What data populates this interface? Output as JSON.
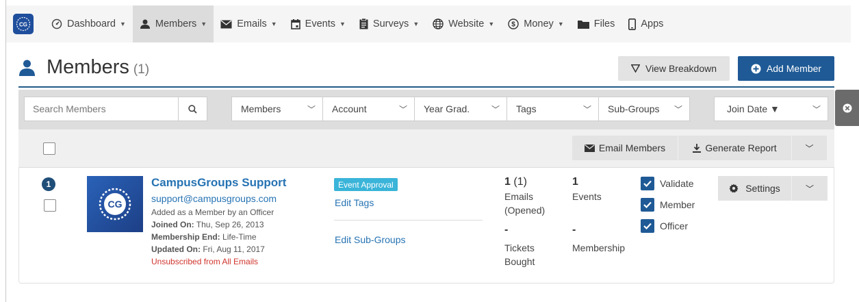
{
  "nav": {
    "items": [
      {
        "label": "Dashboard",
        "dropdown": true
      },
      {
        "label": "Members",
        "dropdown": true,
        "active": true
      },
      {
        "label": "Emails",
        "dropdown": true
      },
      {
        "label": "Events",
        "dropdown": true
      },
      {
        "label": "Surveys",
        "dropdown": true
      },
      {
        "label": "Website",
        "dropdown": true
      },
      {
        "label": "Money",
        "dropdown": true
      },
      {
        "label": "Files",
        "dropdown": false
      },
      {
        "label": "Apps",
        "dropdown": false
      }
    ],
    "logo_text": "CG"
  },
  "header": {
    "title": "Members",
    "count": "(1)",
    "view_breakdown": "View Breakdown",
    "add_member": "Add Member"
  },
  "filters": {
    "search_placeholder": "Search Members",
    "members": "Members",
    "account": "Account",
    "year_grad": "Year Grad.",
    "tags": "Tags",
    "sub_groups": "Sub-Groups",
    "join_date": "Join Date ▼"
  },
  "actions": {
    "email_members": "Email Members",
    "generate_report": "Generate Report"
  },
  "member": {
    "index": "1",
    "name": "CampusGroups Support",
    "email": "support@campusgroups.com",
    "added": "Added as a Member by an Officer",
    "joined_label": "Joined On:",
    "joined_value": "Thu, Sep 26, 2013",
    "membership_end_label": "Membership End:",
    "membership_end_value": "Life-Time",
    "updated_label": "Updated On:",
    "updated_value": "Fri, Aug 11, 2017",
    "unsubscribed": "Unsubscribed from All Emails",
    "tag": "Event Approval",
    "edit_tags": "Edit Tags",
    "edit_subgroups": "Edit Sub-Groups",
    "emails_count": "1",
    "emails_opened": "(1)",
    "emails_label_1": "Emails",
    "emails_label_2": "(Opened)",
    "events_count": "1",
    "events_label": "Events",
    "tickets_value": "-",
    "tickets_label_1": "Tickets",
    "tickets_label_2": "Bought",
    "membership_value": "-",
    "membership_label": "Membership",
    "roles": [
      {
        "label": "Validate",
        "checked": true
      },
      {
        "label": "Member",
        "checked": true
      },
      {
        "label": "Officer",
        "checked": true
      }
    ],
    "settings": "Settings"
  },
  "colors": {
    "primary": "#1f5a96",
    "link": "#2673b3",
    "tag": "#3ab4d9",
    "danger": "#d0342c"
  }
}
